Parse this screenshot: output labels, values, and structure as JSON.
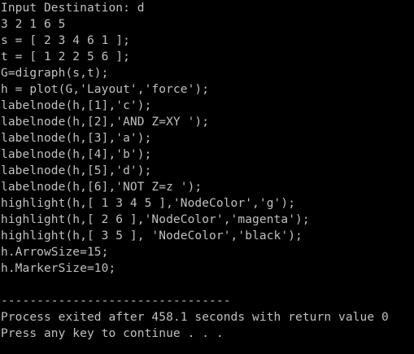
{
  "console": {
    "colors": {
      "background": "#000000",
      "foreground": "#c0c0c0"
    },
    "lines": [
      "Input Destination: d",
      "3 2 1 6 5",
      "s = [ 2 3 4 6 1 ];",
      "t = [ 1 2 2 5 6 ];",
      "G=digraph(s,t);",
      "h = plot(G,'Layout','force');",
      "labelnode(h,[1],'c');",
      "labelnode(h,[2],'AND Z=XY ');",
      "labelnode(h,[3],'a');",
      "labelnode(h,[4],'b');",
      "labelnode(h,[5],'d');",
      "labelnode(h,[6],'NOT Z=z ');",
      "highlight(h,[ 1 3 4 5 ],'NodeColor','g');",
      "highlight(h,[ 2 6 ],'NodeColor','magenta');",
      "highlight(h,[ 3 5 ], 'NodeColor','black');",
      "h.ArrowSize=15;",
      "h.MarkerSize=10;",
      "",
      "--------------------------------",
      "Process exited after 458.1 seconds with return value 0",
      "Press any key to continue . . ."
    ]
  }
}
